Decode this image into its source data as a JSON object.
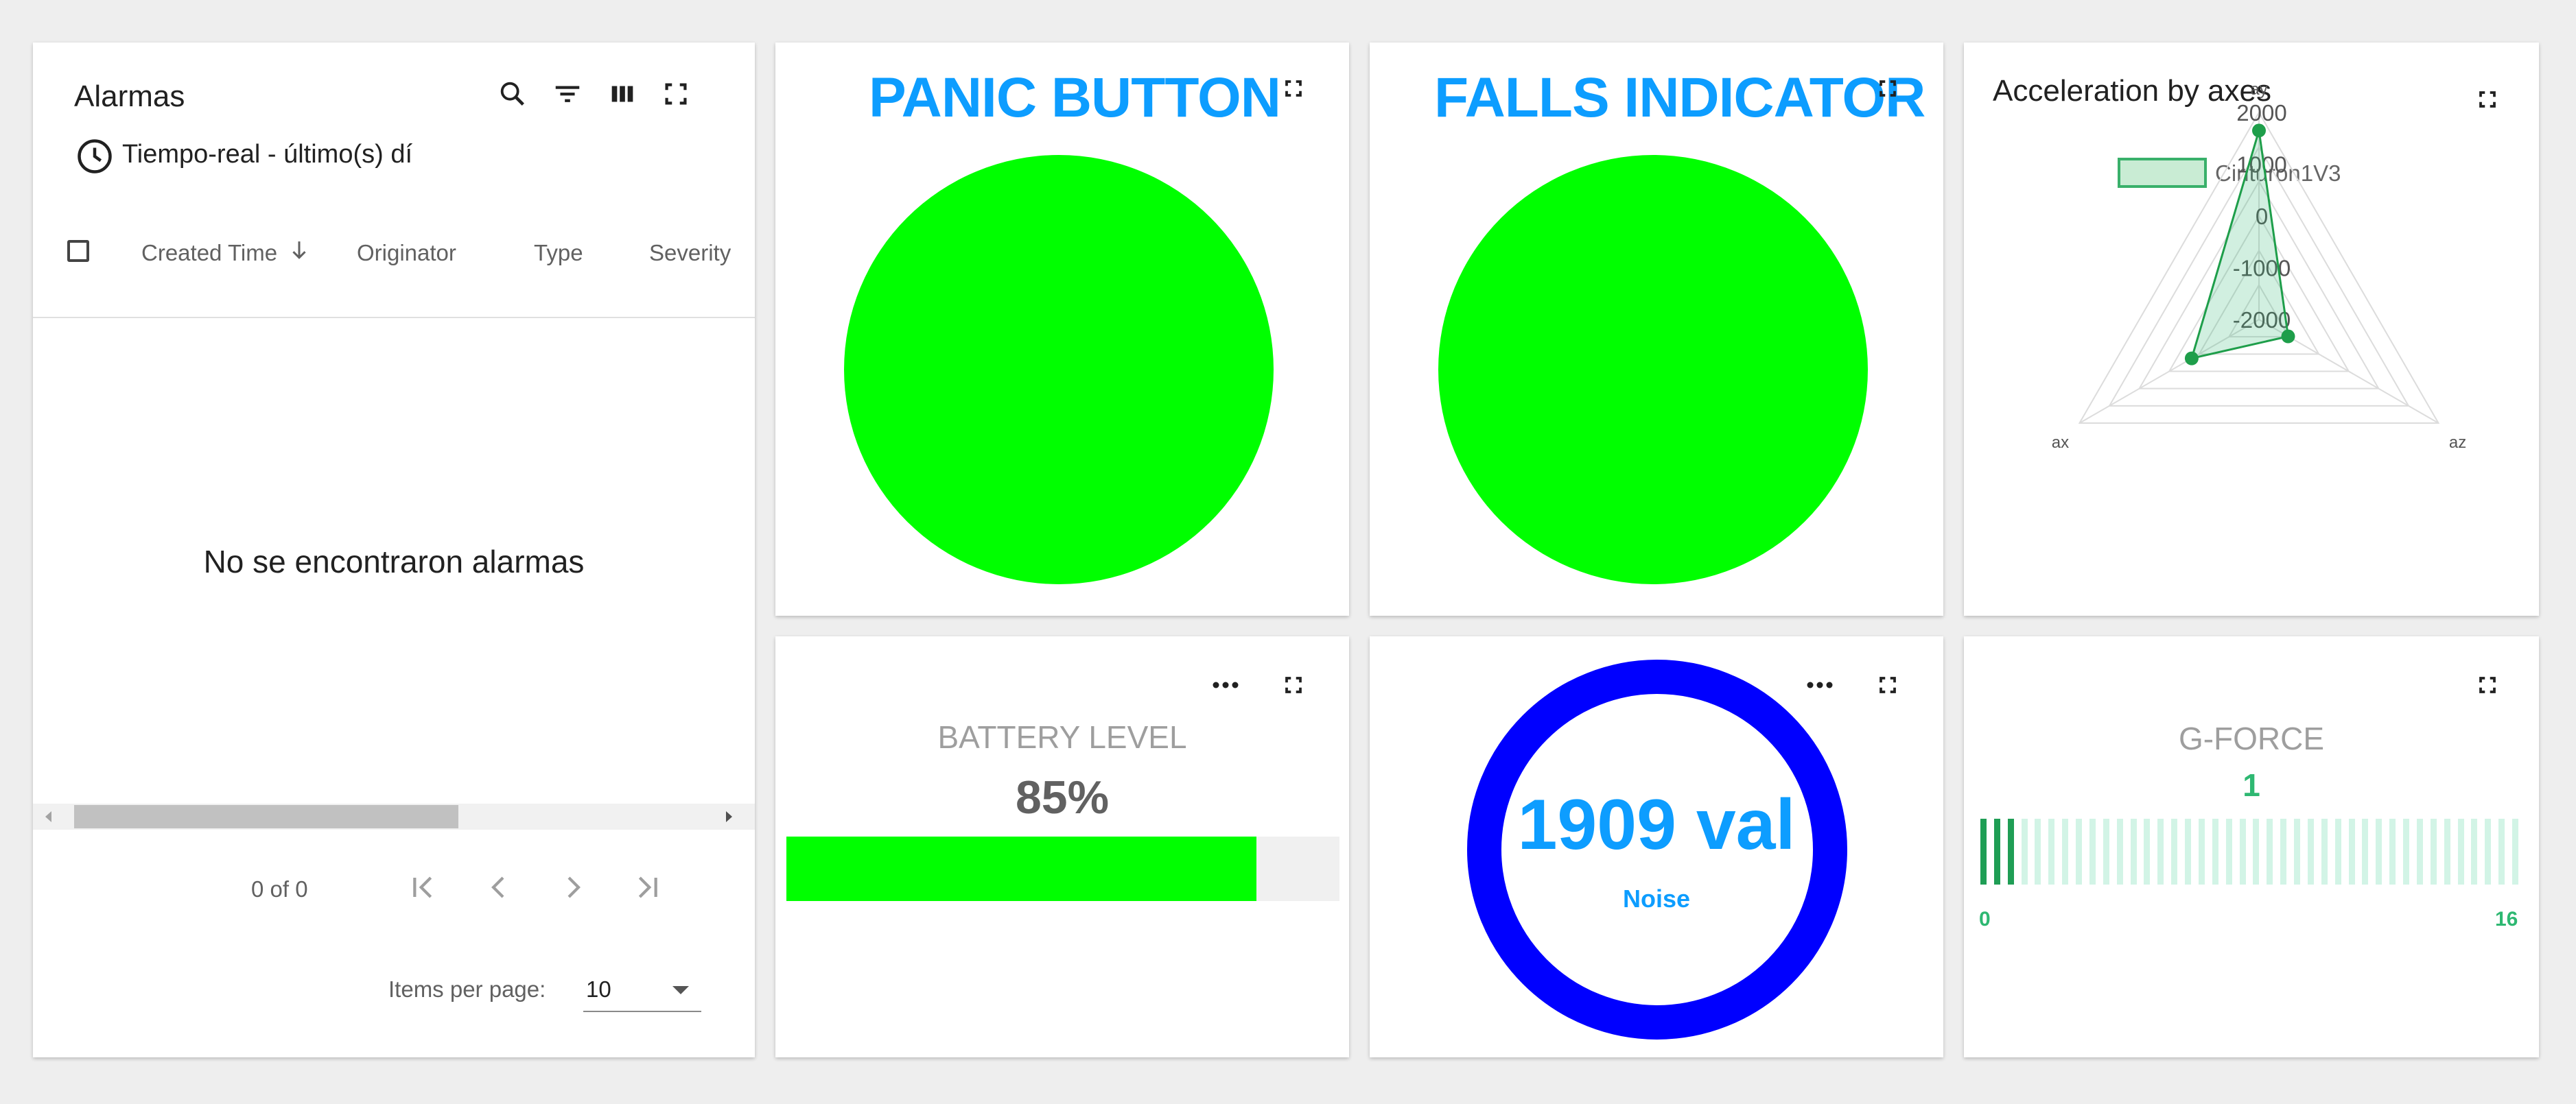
{
  "alarms_widget": {
    "title": "Alarmas",
    "timewindow": "Tiempo-real - último(s) dí",
    "columns": [
      "Created Time",
      "Originator",
      "Type",
      "Severity"
    ],
    "empty_message": "No se encontraron alarmas",
    "paginator": {
      "range_label": "0 of 0",
      "items_per_page_label": "Items per page:",
      "items_per_page_value": "10"
    }
  },
  "panic_widget": {
    "title": "PANIC BUTTON",
    "state_color": "#00ff00"
  },
  "falls_widget": {
    "title": "FALLS INDICATOR",
    "state_color": "#00ff00"
  },
  "accel_widget": {
    "title": "Acceleration by axes",
    "legend": [
      "Cinturon1V3"
    ],
    "radial_ticks": [
      "2000",
      "1000",
      "0",
      "-1000",
      "-2000"
    ],
    "axis_labels": [
      "ay",
      "az",
      "ax"
    ]
  },
  "battery_widget": {
    "title": "BATTERY LEVEL",
    "value_label": "85%",
    "level": 0.85,
    "bar_color": "#00ff00"
  },
  "noise_widget": {
    "value_label": "1909 val",
    "label": "Noise",
    "ring_color": "#0000ff"
  },
  "gforce_widget": {
    "title": "G-FORCE",
    "value_label": "1",
    "min_label": "0",
    "max_label": "16",
    "value": 1,
    "max": 16
  },
  "chart_data": {
    "type": "radar",
    "title": "Acceleration by axes",
    "axes": [
      "ay",
      "az",
      "ax"
    ],
    "rlim": [
      -2000,
      2000
    ],
    "radial_ticks": [
      2000,
      1000,
      0,
      -1000,
      -2000
    ],
    "legend_position": "top",
    "series": [
      {
        "name": "Cinturon1V3",
        "values": [
          1650,
          -1350,
          -500
        ],
        "color": "#1e9e4a"
      }
    ]
  }
}
